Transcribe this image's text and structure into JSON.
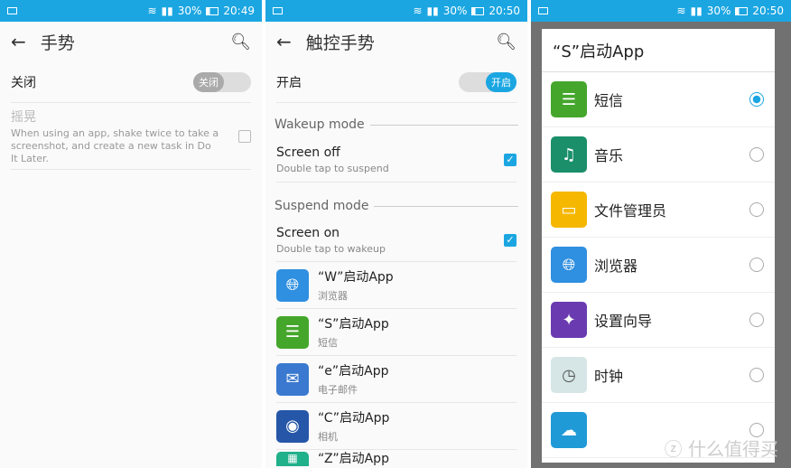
{
  "status_bars": [
    {
      "battery": "30%",
      "time": "20:49"
    },
    {
      "battery": "30%",
      "time": "20:50"
    },
    {
      "battery": "30%",
      "time": "20:50"
    }
  ],
  "screen1": {
    "title": "手势",
    "master_label": "关闭",
    "toggle_label": "关闭",
    "toggle_on": false,
    "shake": {
      "title": "摇晃",
      "desc": "When using an app, shake twice to take a screenshot, and create a new task in Do It Later.",
      "checked": false
    }
  },
  "screen2": {
    "title": "触控手势",
    "master_label": "开启",
    "toggle_label": "开启",
    "toggle_on": true,
    "wakeup_header": "Wakeup mode",
    "screen_off": {
      "title": "Screen off",
      "desc": "Double tap to suspend",
      "checked": true
    },
    "suspend_header": "Suspend mode",
    "screen_on": {
      "title": "Screen on",
      "desc": "Double tap to wakeup",
      "checked": true
    },
    "gestures": [
      {
        "title": "“W”启动App",
        "app": "浏览器",
        "icon": "globe-icon",
        "color": "#2f8fe0"
      },
      {
        "title": "“S”启动App",
        "app": "短信",
        "icon": "message-icon",
        "color": "#45a62c"
      },
      {
        "title": "“e”启动App",
        "app": "电子邮件",
        "icon": "mail-icon",
        "color": "#3a79cf"
      },
      {
        "title": "“C”启动App",
        "app": "相机",
        "icon": "camera-icon",
        "color": "#2556a8"
      },
      {
        "title": "“Z”启动App",
        "app": "",
        "icon": "app-icon",
        "color": "#20b08a"
      }
    ]
  },
  "screen3": {
    "dialog_title": "“S”启动App",
    "selected": 0,
    "options": [
      {
        "label": "短信",
        "icon": "message-icon",
        "color": "#45a62c"
      },
      {
        "label": "音乐",
        "icon": "music-icon",
        "color": "#1a8f6a"
      },
      {
        "label": "文件管理员",
        "icon": "folder-icon",
        "color": "#f5b700"
      },
      {
        "label": "浏览器",
        "icon": "globe-icon",
        "color": "#2f8fe0"
      },
      {
        "label": "设置向导",
        "icon": "wizard-icon",
        "color": "#6a3bb0"
      },
      {
        "label": "时钟",
        "icon": "clock-icon",
        "color": "#d6e6e6"
      },
      {
        "label": "",
        "icon": "weather-icon",
        "color": "#1f9ad6"
      }
    ]
  },
  "watermark": "值 什么值得买"
}
